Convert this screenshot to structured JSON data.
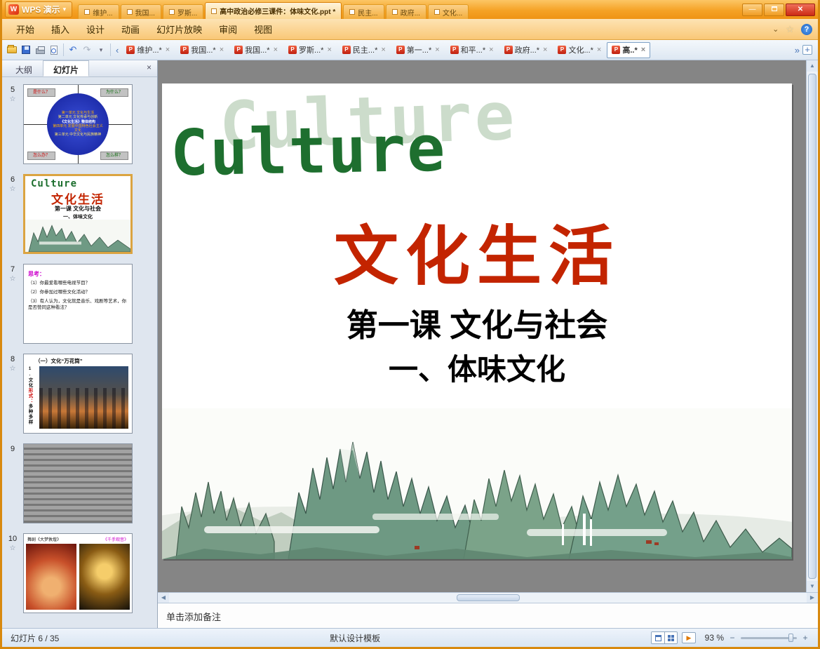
{
  "window": {
    "app_name": "WPS 演示",
    "logo_letter": "W",
    "title": "高中政治必修三课件：体味文化.ppt *",
    "title_tabs_left": [
      "维护...",
      "我国...",
      "罗斯..."
    ],
    "title_tabs_right": [
      "民主...",
      "政府...",
      "文化..."
    ]
  },
  "icons": {
    "caret_down": "▾",
    "chevron_down": "⌄",
    "star": "☆",
    "help": "?",
    "undo": "↶",
    "redo": "↷",
    "tab_prev": "‹",
    "tab_more": "»",
    "tab_add": "+",
    "close": "×",
    "win_min": "—",
    "win_close": "✕",
    "scroll_up": "▲",
    "scroll_down": "▼",
    "scroll_left": "◀",
    "scroll_right": "▶",
    "play": "▶",
    "zoom_out": "−",
    "zoom_in": "+",
    "trans_star": "☆"
  },
  "menu": {
    "items": [
      "开始",
      "插入",
      "设计",
      "动画",
      "幻灯片放映",
      "审阅",
      "视图"
    ]
  },
  "doc_tabs": {
    "tabs": [
      {
        "label": "维护...*"
      },
      {
        "label": "我国...*"
      },
      {
        "label": "我国...*"
      },
      {
        "label": "罗斯...*"
      },
      {
        "label": "民主...*"
      },
      {
        "label": "第一...*"
      },
      {
        "label": "和平...*"
      },
      {
        "label": "政府...*"
      },
      {
        "label": "文化...*"
      },
      {
        "label": "高..*"
      }
    ]
  },
  "sidebar": {
    "tab_outline": "大纲",
    "tab_slides": "幻灯片",
    "slides": [
      {
        "num": "5",
        "corner_tl": "是什么？",
        "corner_tr": "为什么？",
        "corner_bl": "怎么办？",
        "corner_br": "怎么样？",
        "circle_lines": [
          "第一单元 文化与生活",
          "第二单元 文化传承与创新",
          "《文化生活》整体结构",
          "第四单元 发展中国特色社会主义文化",
          "第三单元 中华文化与民族精神"
        ]
      },
      {
        "num": "6",
        "culture": "Culture",
        "title": "文化生活",
        "sub1": "第一课 文化与社会",
        "sub2": "一、体味文化"
      },
      {
        "num": "7",
        "heading": "思考：",
        "item1": "（1）你最爱看哪些电视节目？",
        "item2": "（2）你参加过哪些文化活动？",
        "item3": "（3）有人认为，文化就是音乐、戏剧等艺术，你是否赞同这种看法？"
      },
      {
        "num": "8",
        "title": "（一）文化“万花筒”",
        "side1": "1.文化",
        "side2": "形式：",
        "side3": "多种多样"
      },
      {
        "num": "9"
      },
      {
        "num": "10",
        "caption_left": "舞剧《大梦敦煌》",
        "caption_right": "《千手观音》"
      }
    ]
  },
  "slide": {
    "culture_back": "Culture",
    "culture": "Culture",
    "title": "文化生活",
    "subtitle1": "第一课  文化与社会",
    "subtitle2": "一、体味文化"
  },
  "notes": {
    "placeholder": "单击添加备注"
  },
  "statusbar": {
    "slide_info": "幻灯片 6 / 35",
    "template": "默认设计模板",
    "zoom": "93 %"
  }
}
